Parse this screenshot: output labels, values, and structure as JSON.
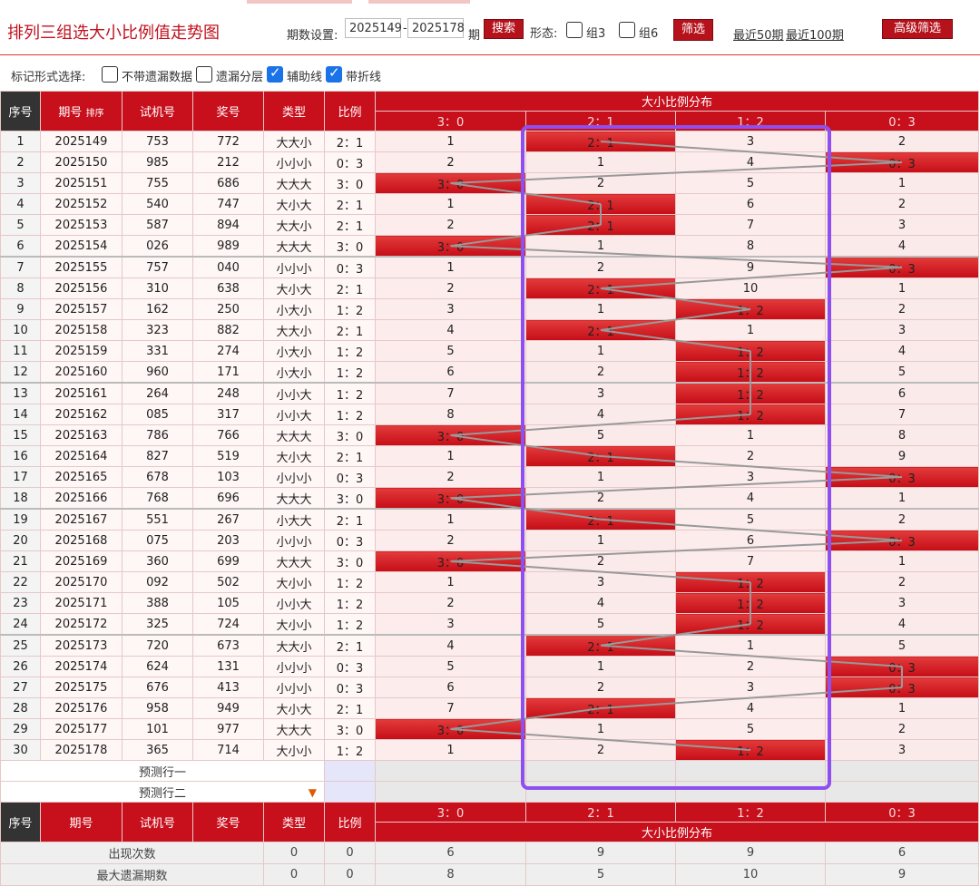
{
  "header": {
    "title": "排列三组选大小比例值走势图",
    "period_label": "期数设置:",
    "period_from": "2025149",
    "period_to": "2025178",
    "period_sep": "-",
    "period_unit": "期",
    "search_label": "搜索",
    "form_label": "形态:",
    "group3_label": "组3",
    "group6_label": "组6",
    "filter_label": "筛选",
    "recent50_label": "最近50期",
    "recent100_label": "最近100期",
    "advanced_label": "高级筛选"
  },
  "marks": {
    "label": "标记形式选择:",
    "options": [
      {
        "label": "不带遗漏数据",
        "checked": false
      },
      {
        "label": "遗漏分层",
        "checked": false
      },
      {
        "label": "辅助线",
        "checked": true
      },
      {
        "label": "带折线",
        "checked": true
      }
    ]
  },
  "table": {
    "headers": {
      "seq": "序号",
      "period": "期号",
      "sort": "排序",
      "test": "试机号",
      "award": "奖号",
      "type": "类型",
      "ratio": "比例",
      "dist": "大小比例分布"
    },
    "dist_cols": [
      "3：0",
      "2：1",
      "1：2",
      "0：3"
    ],
    "rows": [
      {
        "seq": "1",
        "period": "2025149",
        "test": "753",
        "award": "772",
        "type": "大大小",
        "ratio": "2：1",
        "dist": [
          "1",
          "2：1",
          "3",
          "2"
        ],
        "hit": 1
      },
      {
        "seq": "2",
        "period": "2025150",
        "test": "985",
        "award": "212",
        "type": "小小小",
        "ratio": "0：3",
        "dist": [
          "2",
          "1",
          "4",
          "0：3"
        ],
        "hit": 3
      },
      {
        "seq": "3",
        "period": "2025151",
        "test": "755",
        "award": "686",
        "type": "大大大",
        "ratio": "3：0",
        "dist": [
          "3：0",
          "2",
          "5",
          "1"
        ],
        "hit": 0
      },
      {
        "seq": "4",
        "period": "2025152",
        "test": "540",
        "award": "747",
        "type": "大小大",
        "ratio": "2：1",
        "dist": [
          "1",
          "2：1",
          "6",
          "2"
        ],
        "hit": 1
      },
      {
        "seq": "5",
        "period": "2025153",
        "test": "587",
        "award": "894",
        "type": "大大小",
        "ratio": "2：1",
        "dist": [
          "2",
          "2：1",
          "7",
          "3"
        ],
        "hit": 1
      },
      {
        "seq": "6",
        "period": "2025154",
        "test": "026",
        "award": "989",
        "type": "大大大",
        "ratio": "3：0",
        "dist": [
          "3：0",
          "1",
          "8",
          "4"
        ],
        "hit": 0
      },
      {
        "seq": "7",
        "period": "2025155",
        "test": "757",
        "award": "040",
        "type": "小小小",
        "ratio": "0：3",
        "dist": [
          "1",
          "2",
          "9",
          "0：3"
        ],
        "hit": 3
      },
      {
        "seq": "8",
        "period": "2025156",
        "test": "310",
        "award": "638",
        "type": "大小大",
        "ratio": "2：1",
        "dist": [
          "2",
          "2：1",
          "10",
          "1"
        ],
        "hit": 1
      },
      {
        "seq": "9",
        "period": "2025157",
        "test": "162",
        "award": "250",
        "type": "小大小",
        "ratio": "1：2",
        "dist": [
          "3",
          "1",
          "1：2",
          "2"
        ],
        "hit": 2
      },
      {
        "seq": "10",
        "period": "2025158",
        "test": "323",
        "award": "882",
        "type": "大大小",
        "ratio": "2：1",
        "dist": [
          "4",
          "2：1",
          "1",
          "3"
        ],
        "hit": 1
      },
      {
        "seq": "11",
        "period": "2025159",
        "test": "331",
        "award": "274",
        "type": "小大小",
        "ratio": "1：2",
        "dist": [
          "5",
          "1",
          "1：2",
          "4"
        ],
        "hit": 2
      },
      {
        "seq": "12",
        "period": "2025160",
        "test": "960",
        "award": "171",
        "type": "小大小",
        "ratio": "1：2",
        "dist": [
          "6",
          "2",
          "1：2",
          "5"
        ],
        "hit": 2
      },
      {
        "seq": "13",
        "period": "2025161",
        "test": "264",
        "award": "248",
        "type": "小小大",
        "ratio": "1：2",
        "dist": [
          "7",
          "3",
          "1：2",
          "6"
        ],
        "hit": 2
      },
      {
        "seq": "14",
        "period": "2025162",
        "test": "085",
        "award": "317",
        "type": "小小大",
        "ratio": "1：2",
        "dist": [
          "8",
          "4",
          "1：2",
          "7"
        ],
        "hit": 2
      },
      {
        "seq": "15",
        "period": "2025163",
        "test": "786",
        "award": "766",
        "type": "大大大",
        "ratio": "3：0",
        "dist": [
          "3：0",
          "5",
          "1",
          "8"
        ],
        "hit": 0
      },
      {
        "seq": "16",
        "period": "2025164",
        "test": "827",
        "award": "519",
        "type": "大小大",
        "ratio": "2：1",
        "dist": [
          "1",
          "2：1",
          "2",
          "9"
        ],
        "hit": 1
      },
      {
        "seq": "17",
        "period": "2025165",
        "test": "678",
        "award": "103",
        "type": "小小小",
        "ratio": "0：3",
        "dist": [
          "2",
          "1",
          "3",
          "0：3"
        ],
        "hit": 3
      },
      {
        "seq": "18",
        "period": "2025166",
        "test": "768",
        "award": "696",
        "type": "大大大",
        "ratio": "3：0",
        "dist": [
          "3：0",
          "2",
          "4",
          "1"
        ],
        "hit": 0
      },
      {
        "seq": "19",
        "period": "2025167",
        "test": "551",
        "award": "267",
        "type": "小大大",
        "ratio": "2：1",
        "dist": [
          "1",
          "2：1",
          "5",
          "2"
        ],
        "hit": 1
      },
      {
        "seq": "20",
        "period": "2025168",
        "test": "075",
        "award": "203",
        "type": "小小小",
        "ratio": "0：3",
        "dist": [
          "2",
          "1",
          "6",
          "0：3"
        ],
        "hit": 3
      },
      {
        "seq": "21",
        "period": "2025169",
        "test": "360",
        "award": "699",
        "type": "大大大",
        "ratio": "3：0",
        "dist": [
          "3：0",
          "2",
          "7",
          "1"
        ],
        "hit": 0
      },
      {
        "seq": "22",
        "period": "2025170",
        "test": "092",
        "award": "502",
        "type": "大小小",
        "ratio": "1：2",
        "dist": [
          "1",
          "3",
          "1：2",
          "2"
        ],
        "hit": 2
      },
      {
        "seq": "23",
        "period": "2025171",
        "test": "388",
        "award": "105",
        "type": "小小大",
        "ratio": "1：2",
        "dist": [
          "2",
          "4",
          "1：2",
          "3"
        ],
        "hit": 2
      },
      {
        "seq": "24",
        "period": "2025172",
        "test": "325",
        "award": "724",
        "type": "大小小",
        "ratio": "1：2",
        "dist": [
          "3",
          "5",
          "1：2",
          "4"
        ],
        "hit": 2
      },
      {
        "seq": "25",
        "period": "2025173",
        "test": "720",
        "award": "673",
        "type": "大大小",
        "ratio": "2：1",
        "dist": [
          "4",
          "2：1",
          "1",
          "5"
        ],
        "hit": 1
      },
      {
        "seq": "26",
        "period": "2025174",
        "test": "624",
        "award": "131",
        "type": "小小小",
        "ratio": "0：3",
        "dist": [
          "5",
          "1",
          "2",
          "0：3"
        ],
        "hit": 3
      },
      {
        "seq": "27",
        "period": "2025175",
        "test": "676",
        "award": "413",
        "type": "小小小",
        "ratio": "0：3",
        "dist": [
          "6",
          "2",
          "3",
          "0：3"
        ],
        "hit": 3
      },
      {
        "seq": "28",
        "period": "2025176",
        "test": "958",
        "award": "949",
        "type": "大小大",
        "ratio": "2：1",
        "dist": [
          "7",
          "2：1",
          "4",
          "1"
        ],
        "hit": 1
      },
      {
        "seq": "29",
        "period": "2025177",
        "test": "101",
        "award": "977",
        "type": "大大大",
        "ratio": "3：0",
        "dist": [
          "3：0",
          "1",
          "5",
          "2"
        ],
        "hit": 0
      },
      {
        "seq": "30",
        "period": "2025178",
        "test": "365",
        "award": "714",
        "type": "大小小",
        "ratio": "1：2",
        "dist": [
          "1",
          "2",
          "1：2",
          "3"
        ],
        "hit": 2
      }
    ],
    "predict1": "预测行一",
    "predict2": "预测行二",
    "stats": [
      {
        "label": "出现次数",
        "type": "0",
        "ratio": "0",
        "values": [
          "6",
          "9",
          "9",
          "6"
        ]
      },
      {
        "label": "最大遗漏期数",
        "type": "0",
        "ratio": "0",
        "values": [
          "8",
          "5",
          "10",
          "9"
        ]
      }
    ]
  },
  "colors": {
    "accent": "#c8101d",
    "hit": "#d21a22",
    "highlight": "#8e4ff0",
    "trend": "#999999"
  }
}
